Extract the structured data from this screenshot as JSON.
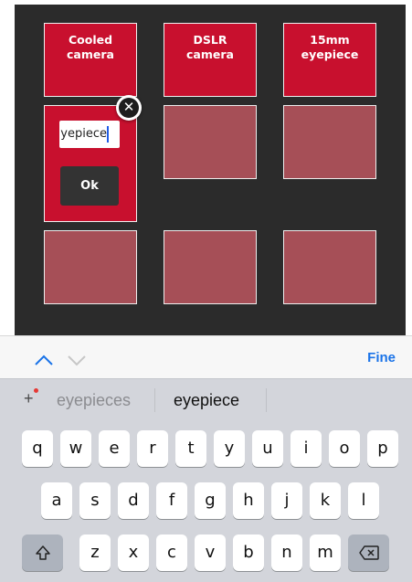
{
  "tiles": {
    "cooled_camera": "Cooled\ncamera",
    "dslr_camera": "DSLR\ncamera",
    "eyepiece_15mm": "15mm\neyepiece"
  },
  "editor": {
    "input_value": "yepiece",
    "ok_label": "Ok",
    "close_icon": "close-icon"
  },
  "toolbar": {
    "done_label": "Fine",
    "up_icon": "chevron-up-icon",
    "down_icon": "chevron-down-icon"
  },
  "suggestions": {
    "left": "eyepieces",
    "center": "eyepiece"
  },
  "keyboard": {
    "row1": [
      "q",
      "w",
      "e",
      "r",
      "t",
      "y",
      "u",
      "i",
      "o",
      "p"
    ],
    "row2": [
      "a",
      "s",
      "d",
      "f",
      "g",
      "h",
      "j",
      "k",
      "l"
    ],
    "row3": [
      "z",
      "x",
      "c",
      "v",
      "b",
      "n",
      "m"
    ],
    "shift_icon": "shift-icon",
    "backspace_icon": "backspace-icon"
  },
  "colors": {
    "tile_red": "#c8102e",
    "tile_empty": "#a64f57",
    "panel_bg": "#2b2b2b",
    "accent_blue": "#1a73e8"
  }
}
